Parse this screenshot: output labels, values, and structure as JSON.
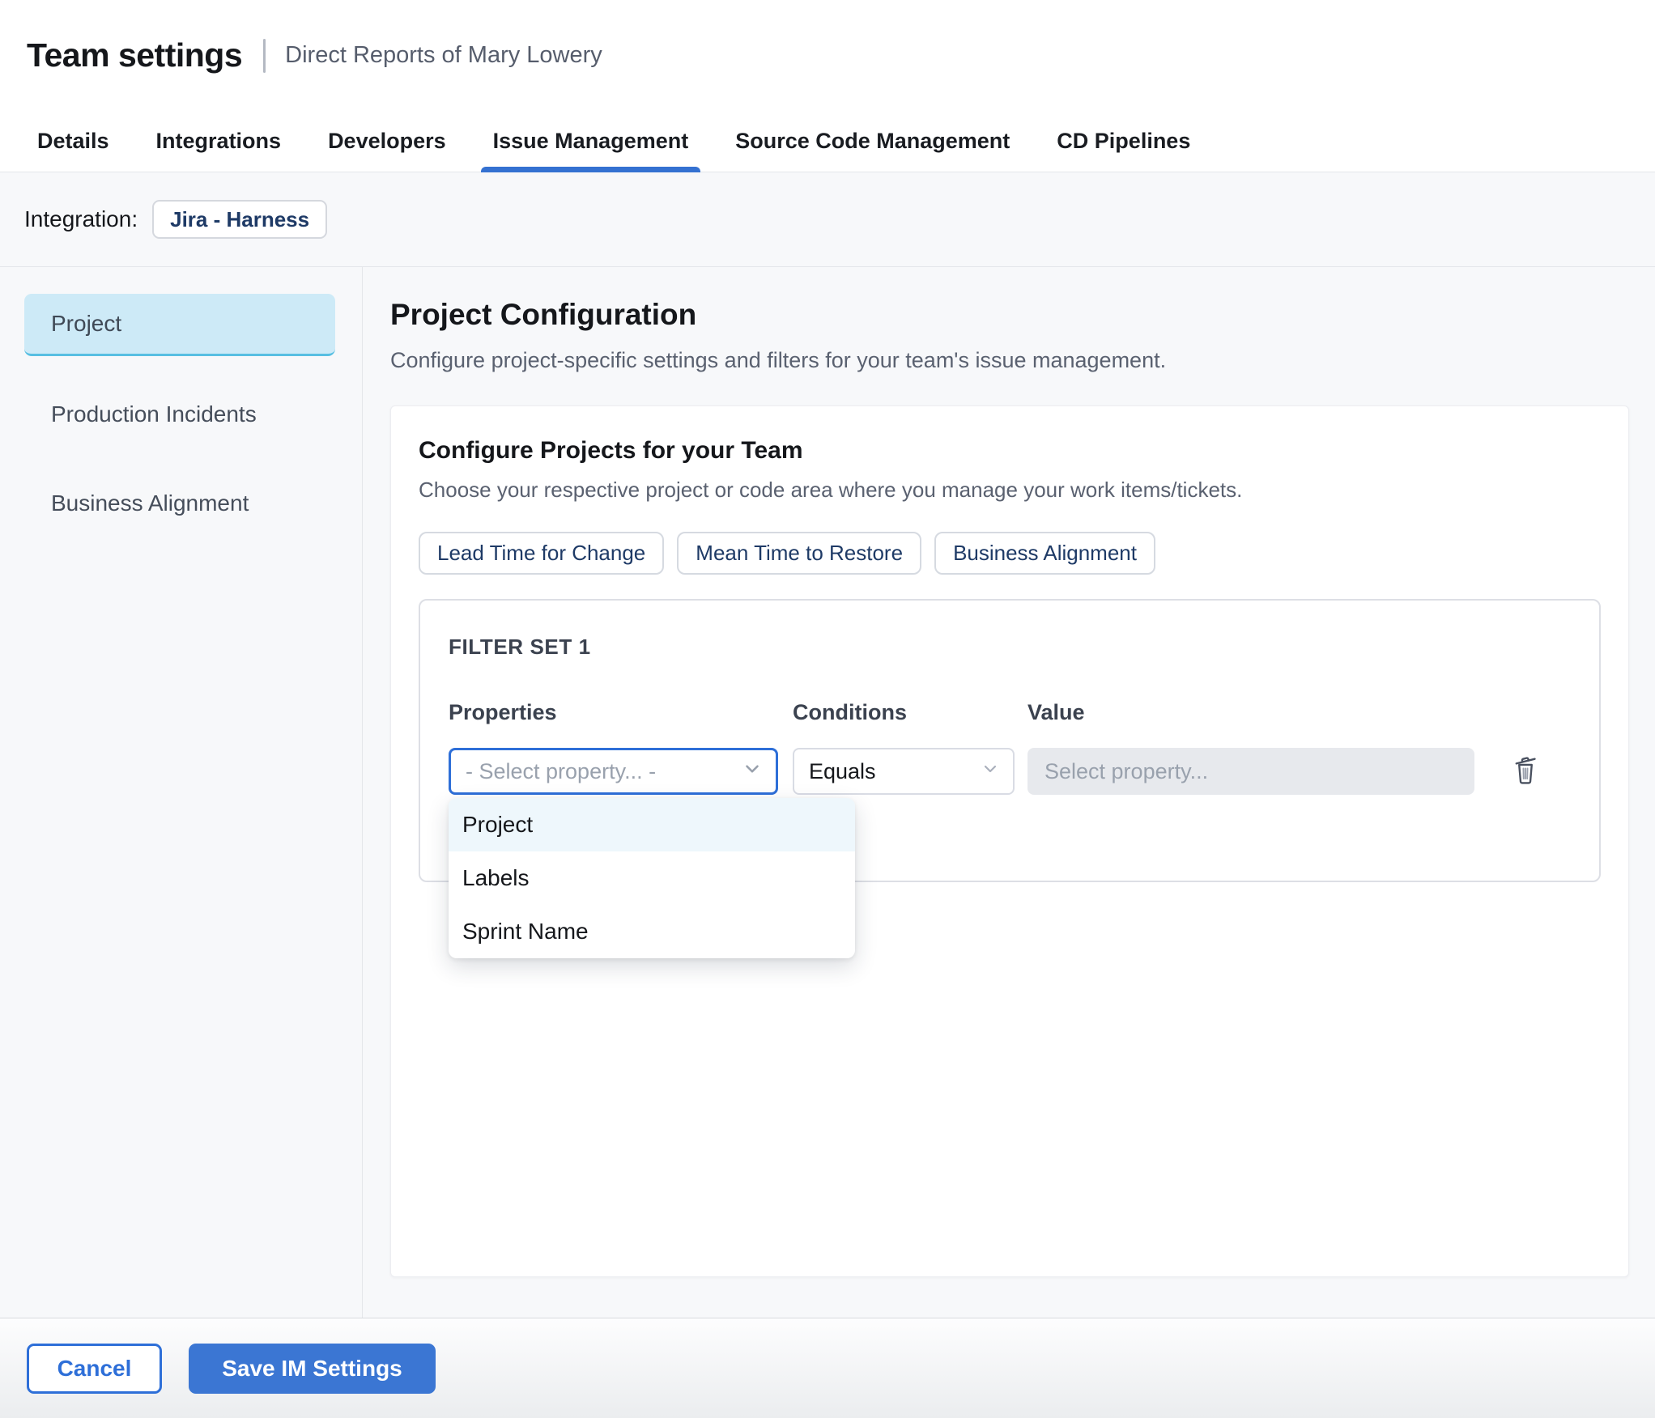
{
  "header": {
    "title": "Team settings",
    "subtitle": "Direct Reports of Mary Lowery"
  },
  "tabs": [
    {
      "label": "Details",
      "active": false
    },
    {
      "label": "Integrations",
      "active": false
    },
    {
      "label": "Developers",
      "active": false
    },
    {
      "label": "Issue Management",
      "active": true
    },
    {
      "label": "Source Code Management",
      "active": false
    },
    {
      "label": "CD Pipelines",
      "active": false
    }
  ],
  "integration_bar": {
    "label": "Integration:",
    "chip": "Jira - Harness"
  },
  "sidebar": {
    "items": [
      {
        "label": "Project",
        "selected": true
      },
      {
        "label": "Production Incidents",
        "selected": false
      },
      {
        "label": "Business Alignment",
        "selected": false
      }
    ]
  },
  "main": {
    "title": "Project Configuration",
    "description": "Configure project-specific settings and filters for your team's issue management.",
    "card": {
      "title": "Configure Projects for your Team",
      "description": "Choose your respective project or code area where you manage your work items/tickets.",
      "pills": [
        {
          "label": "Lead Time for Change"
        },
        {
          "label": "Mean Time to Restore"
        },
        {
          "label": "Business Alignment"
        }
      ],
      "filter_set": {
        "title": "FILTER SET 1",
        "properties_header": "Properties",
        "conditions_header": "Conditions",
        "value_header": "Value",
        "property_select": {
          "placeholder": "- Select property... -"
        },
        "condition_select": {
          "value": "Equals"
        },
        "value_input": {
          "placeholder": "Select property..."
        },
        "dropdown": {
          "options": [
            {
              "label": "Project",
              "highlighted": true
            },
            {
              "label": "Labels",
              "highlighted": false
            },
            {
              "label": "Sprint Name",
              "highlighted": false
            }
          ]
        }
      }
    }
  },
  "footer": {
    "cancel_label": "Cancel",
    "save_label": "Save IM Settings"
  },
  "icons": {
    "chevron_down": "chevron-down-icon",
    "trash": "trash-icon"
  },
  "colors": {
    "accent_blue": "#3b76d3",
    "tab_underline": "#3471d1",
    "focus_border": "#2e6fd8",
    "selected_item_bg": "#cdeaf7",
    "selected_item_border": "#57bfe2",
    "dropdown_highlight": "#eef7fc",
    "chip_text": "#1e3a66",
    "content_bg": "#f7f8fa"
  }
}
